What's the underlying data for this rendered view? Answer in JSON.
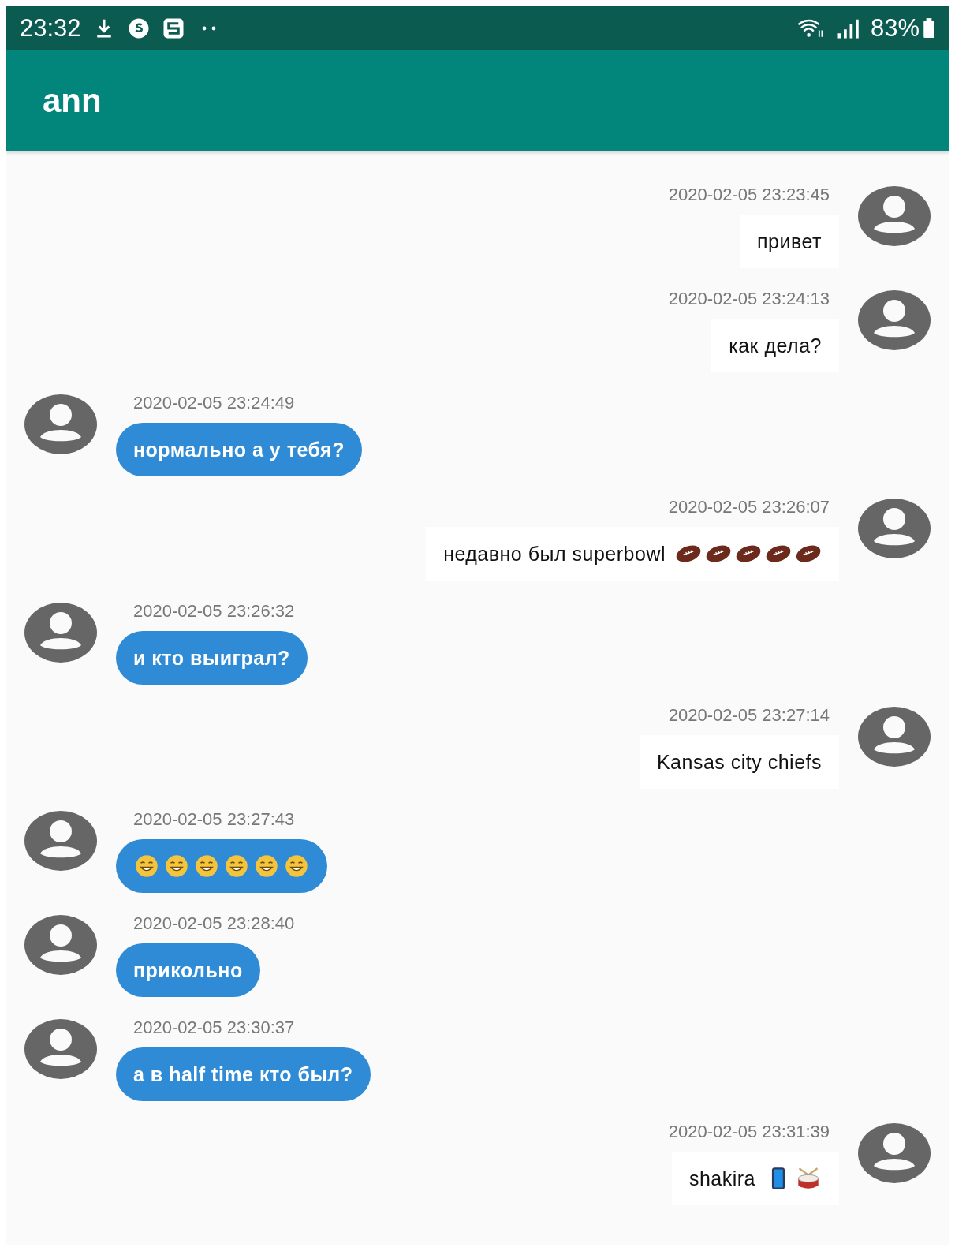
{
  "status_bar": {
    "time": "23:32",
    "battery": "83%"
  },
  "app_bar": {
    "title": "ann"
  },
  "messages": [
    {
      "kind": "outgoing",
      "time": "2020-02-05 23:23:45",
      "text": "привет"
    },
    {
      "kind": "outgoing",
      "time": "2020-02-05 23:24:13",
      "text": "как дела?"
    },
    {
      "kind": "incoming",
      "time": "2020-02-05 23:24:49",
      "text": "нормально а у тебя?"
    },
    {
      "kind": "outgoing",
      "time": "2020-02-05 23:26:07",
      "text": "недавно был superbowl",
      "emojis": [
        {
          "kind": "football"
        },
        {
          "kind": "football"
        },
        {
          "kind": "football"
        },
        {
          "kind": "football"
        },
        {
          "kind": "football"
        }
      ]
    },
    {
      "kind": "incoming",
      "time": "2020-02-05 23:26:32",
      "text": "и кто выиграл?"
    },
    {
      "kind": "outgoing",
      "time": "2020-02-05 23:27:14",
      "text": "Kansas city chiefs"
    },
    {
      "kind": "incoming",
      "time": "2020-02-05 23:27:43",
      "emojis": [
        {
          "kind": "grin"
        },
        {
          "kind": "grin"
        },
        {
          "kind": "grin"
        },
        {
          "kind": "grin"
        },
        {
          "kind": "grin"
        },
        {
          "kind": "grin"
        }
      ]
    },
    {
      "kind": "incoming",
      "time": "2020-02-05 23:28:40",
      "text": "прикольно"
    },
    {
      "kind": "incoming",
      "time": "2020-02-05 23:30:37",
      "text": "а в half time кто был?"
    },
    {
      "kind": "outgoing",
      "time": "2020-02-05 23:31:39",
      "text": "shakira",
      "emojis": [
        {
          "kind": "phone"
        },
        {
          "kind": "drum"
        }
      ]
    }
  ]
}
